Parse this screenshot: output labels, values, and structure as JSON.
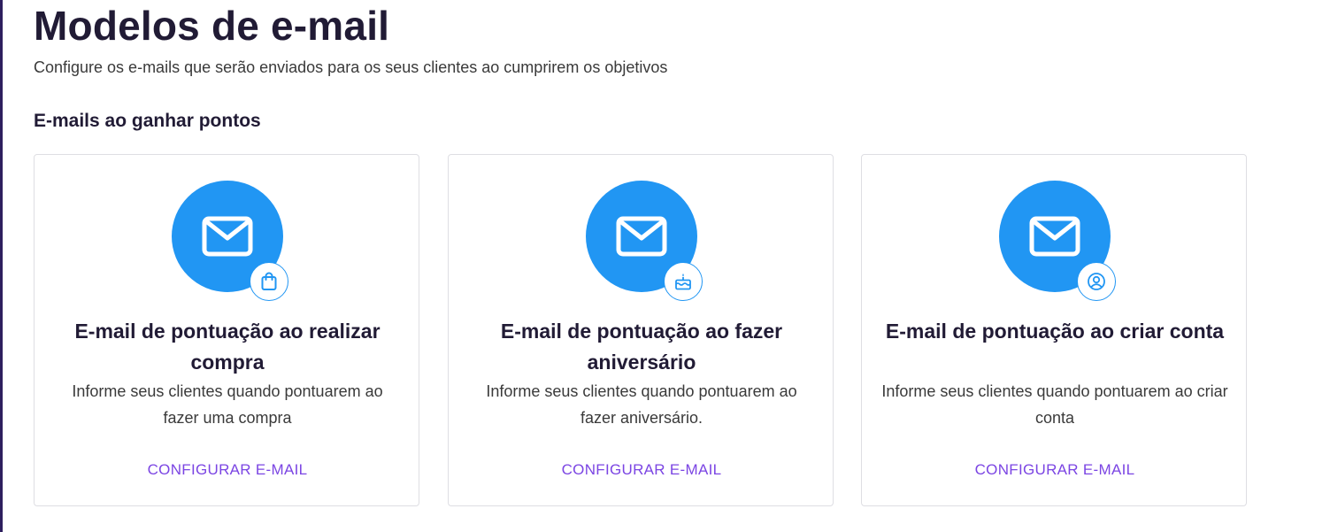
{
  "header": {
    "title": "Modelos de e-mail",
    "subtitle": "Configure os e-mails que serão enviados para os seus clientes ao cumprirem os objetivos"
  },
  "section": {
    "title": "E-mails ao ganhar pontos"
  },
  "cards": [
    {
      "icon": "mail-icon",
      "badge_icon": "shopping-bag-icon",
      "title": "E-mail de pontuação ao realizar compra",
      "description": "Informe seus clientes quando pontuarem ao fazer uma compra",
      "action_label": "CONFIGURAR E-MAIL"
    },
    {
      "icon": "mail-icon",
      "badge_icon": "birthday-cake-icon",
      "title": "E-mail de pontuação ao fazer aniversário",
      "description": "Informe seus clientes quando pontuarem ao fazer aniversário.",
      "action_label": "CONFIGURAR E-MAIL"
    },
    {
      "icon": "mail-icon",
      "badge_icon": "user-account-icon",
      "title": "E-mail de pontuação ao criar conta",
      "description": "Informe seus clientes quando pontuarem ao criar conta",
      "action_label": "CONFIGURAR E-MAIL"
    }
  ],
  "colors": {
    "accent_blue": "#2196f3",
    "action_purple": "#7b45e3",
    "title_dark": "#211b35",
    "sidebar_edge": "#2e1f5e"
  }
}
